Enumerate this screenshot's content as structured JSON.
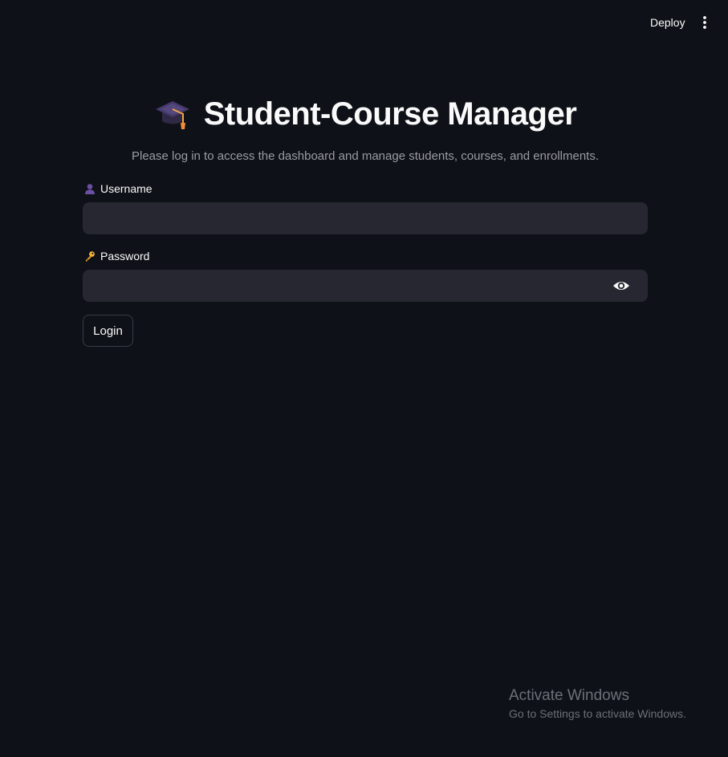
{
  "header": {
    "deploy_label": "Deploy",
    "menu_icon": "more-vertical-icon"
  },
  "login": {
    "title_icon": "graduation-cap-icon",
    "title": "Student-Course Manager",
    "subtitle": "Please log in to access the dashboard and manage students, courses, and enrollments.",
    "username": {
      "icon": "user-icon",
      "label": "Username",
      "value": ""
    },
    "password": {
      "icon": "key-icon",
      "label": "Password",
      "value": "",
      "toggle_icon": "eye-icon"
    },
    "submit_label": "Login"
  },
  "watermark": {
    "title": "Activate Windows",
    "subtitle": "Go to Settings to activate Windows."
  },
  "colors": {
    "background": "#0e1117",
    "input_background": "#262730",
    "text": "#fafafa",
    "muted_text": "#9a9ca3"
  }
}
